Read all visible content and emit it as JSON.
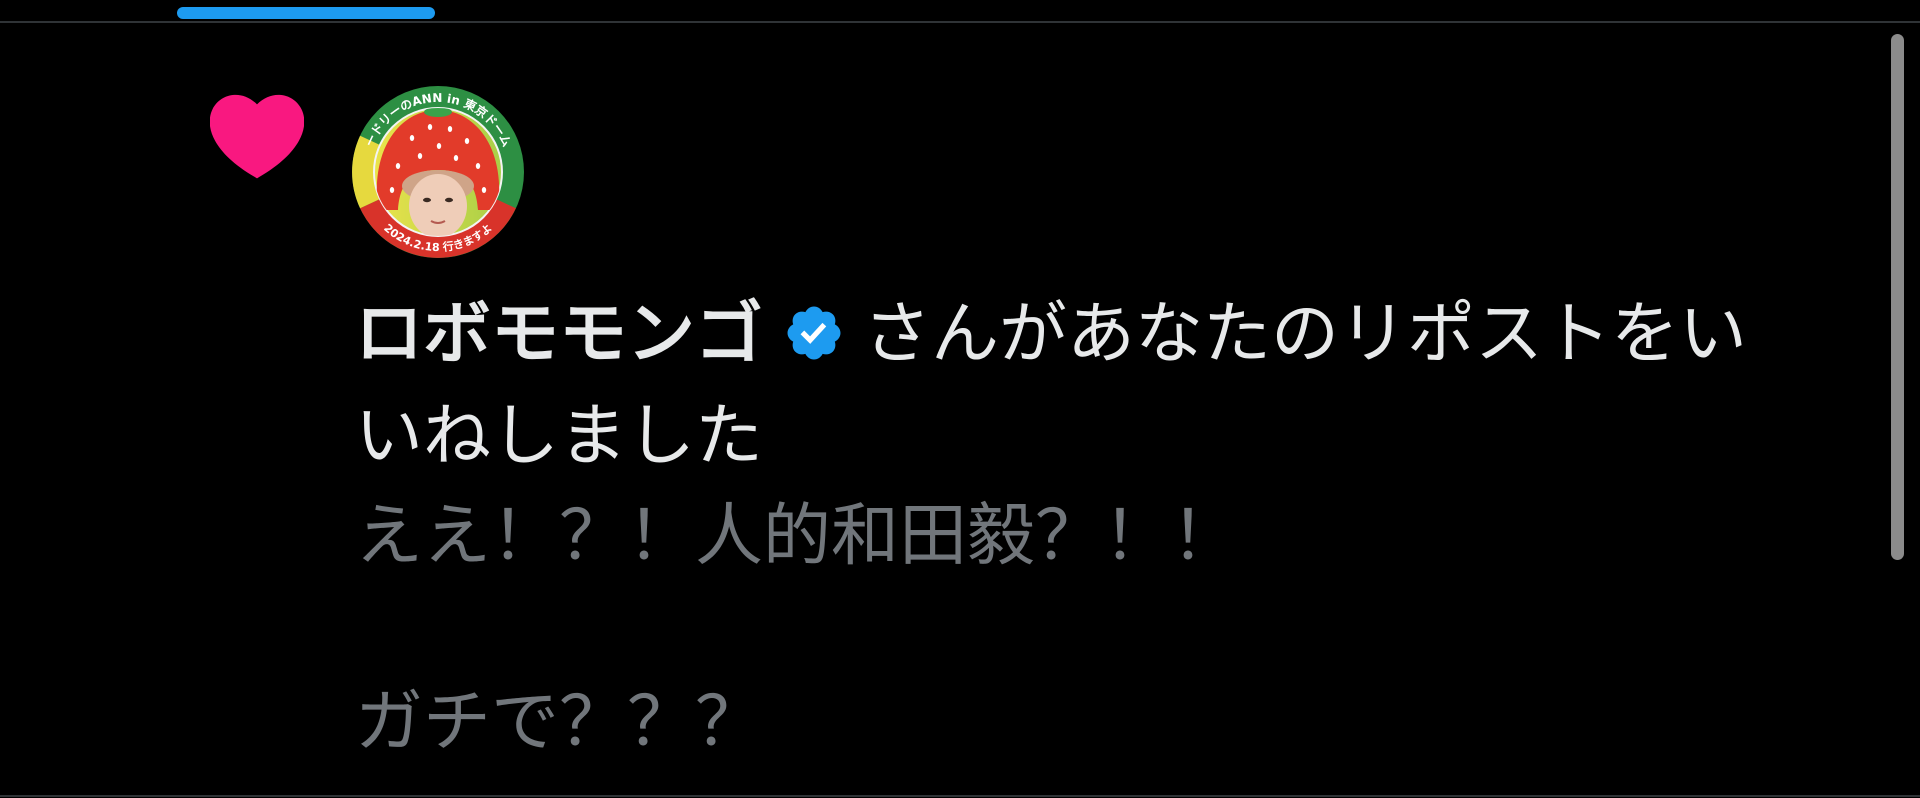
{
  "colors": {
    "background": "#000000",
    "divider": "#2f3336",
    "accent": "#1d9bf0",
    "like": "#f91880",
    "text_primary": "#e7e9ea",
    "text_secondary": "#71767b",
    "scrollbar": "#8b8b8b"
  },
  "notification": {
    "type_icon": "heart-icon",
    "avatar": {
      "icon": "avatar-image",
      "ring_text_top": "ードリーのANN in 東京ドーム",
      "ring_text_bottom": "2024.2.18 行きますよ"
    },
    "user_name": "ロボモモンゴ",
    "verified_icon": "verified-badge-icon",
    "action_text": "さんがあなたのリポストをいいねしました",
    "post_text": "ええ！？！人的和田毅？！！\n\nガチで？？？"
  }
}
